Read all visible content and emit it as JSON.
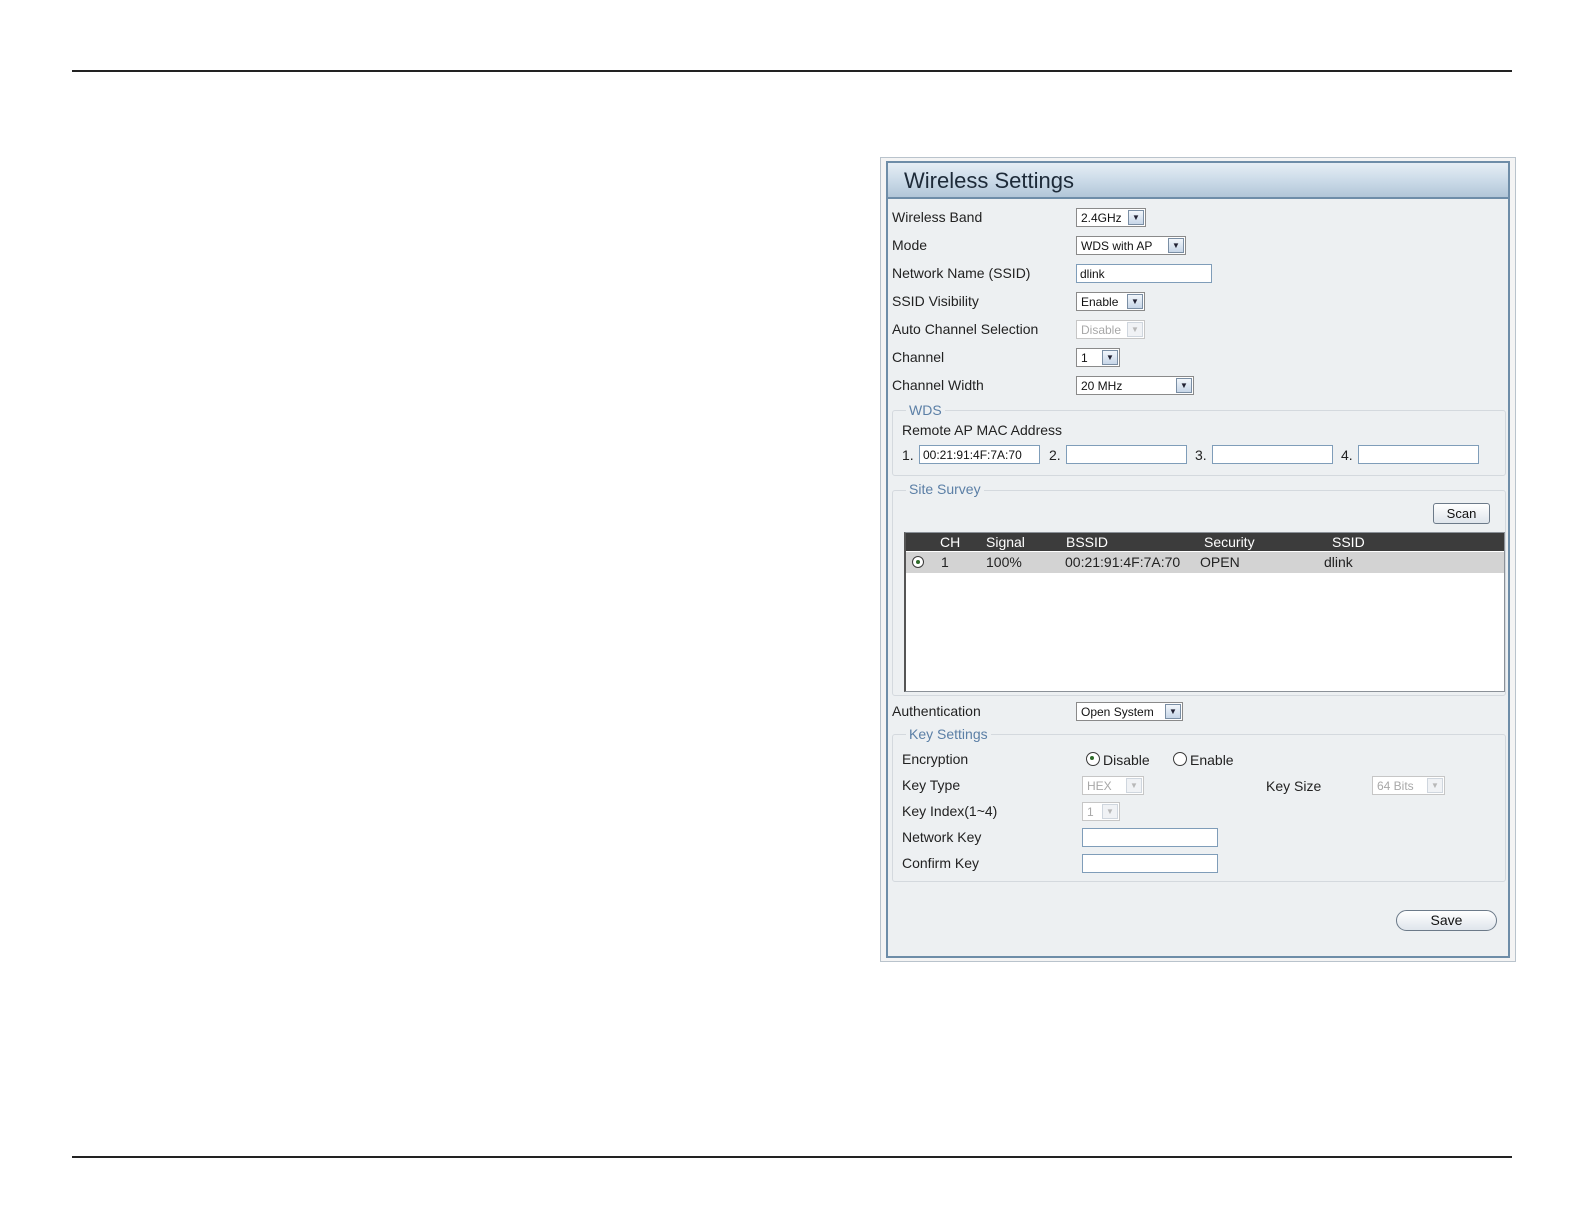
{
  "panel": {
    "title": "Wireless Settings",
    "wireless_band": {
      "label": "Wireless Band",
      "value": "2.4GHz"
    },
    "mode": {
      "label": "Mode",
      "value": "WDS with AP"
    },
    "ssid": {
      "label": "Network Name (SSID)",
      "value": "dlink"
    },
    "ssid_visibility": {
      "label": "SSID Visibility",
      "value": "Enable"
    },
    "auto_channel": {
      "label": "Auto Channel Selection",
      "value": "Disable",
      "disabled": true
    },
    "channel": {
      "label": "Channel",
      "value": "1"
    },
    "channel_width": {
      "label": "Channel Width",
      "value": "20 MHz"
    }
  },
  "wds": {
    "legend": "WDS",
    "remote_label": "Remote AP MAC Address",
    "entries": [
      {
        "index": "1.",
        "value": "00:21:91:4F:7A:70"
      },
      {
        "index": "2.",
        "value": ""
      },
      {
        "index": "3.",
        "value": ""
      },
      {
        "index": "4.",
        "value": ""
      }
    ]
  },
  "site_survey": {
    "legend": "Site Survey",
    "scan_label": "Scan",
    "columns": [
      "CH",
      "Signal",
      "BSSID",
      "Security",
      "SSID"
    ],
    "rows": [
      {
        "selected": true,
        "ch": "1",
        "signal": "100%",
        "bssid": "00:21:91:4F:7A:70",
        "security": "OPEN",
        "ssid": "dlink"
      }
    ]
  },
  "authentication": {
    "label": "Authentication",
    "value": "Open System"
  },
  "key_settings": {
    "legend": "Key Settings",
    "encryption": {
      "label": "Encryption",
      "options": [
        "Disable",
        "Enable"
      ],
      "selected": "Disable"
    },
    "key_type": {
      "label": "Key Type",
      "value": "HEX",
      "disabled": true
    },
    "key_size": {
      "label": "Key Size",
      "value": "64 Bits",
      "disabled": true
    },
    "key_index": {
      "label": "Key Index(1~4)",
      "value": "1",
      "disabled": true
    },
    "network_key": {
      "label": "Network Key",
      "value": ""
    },
    "confirm_key": {
      "label": "Confirm Key",
      "value": ""
    }
  },
  "save_label": "Save",
  "colors": {
    "title_bar": "#c9d9e7",
    "panel_border": "#6e8da8",
    "legend_text": "#5b7fa6",
    "table_header": "#3c3c3c",
    "selected_row": "#d3d3d3"
  }
}
